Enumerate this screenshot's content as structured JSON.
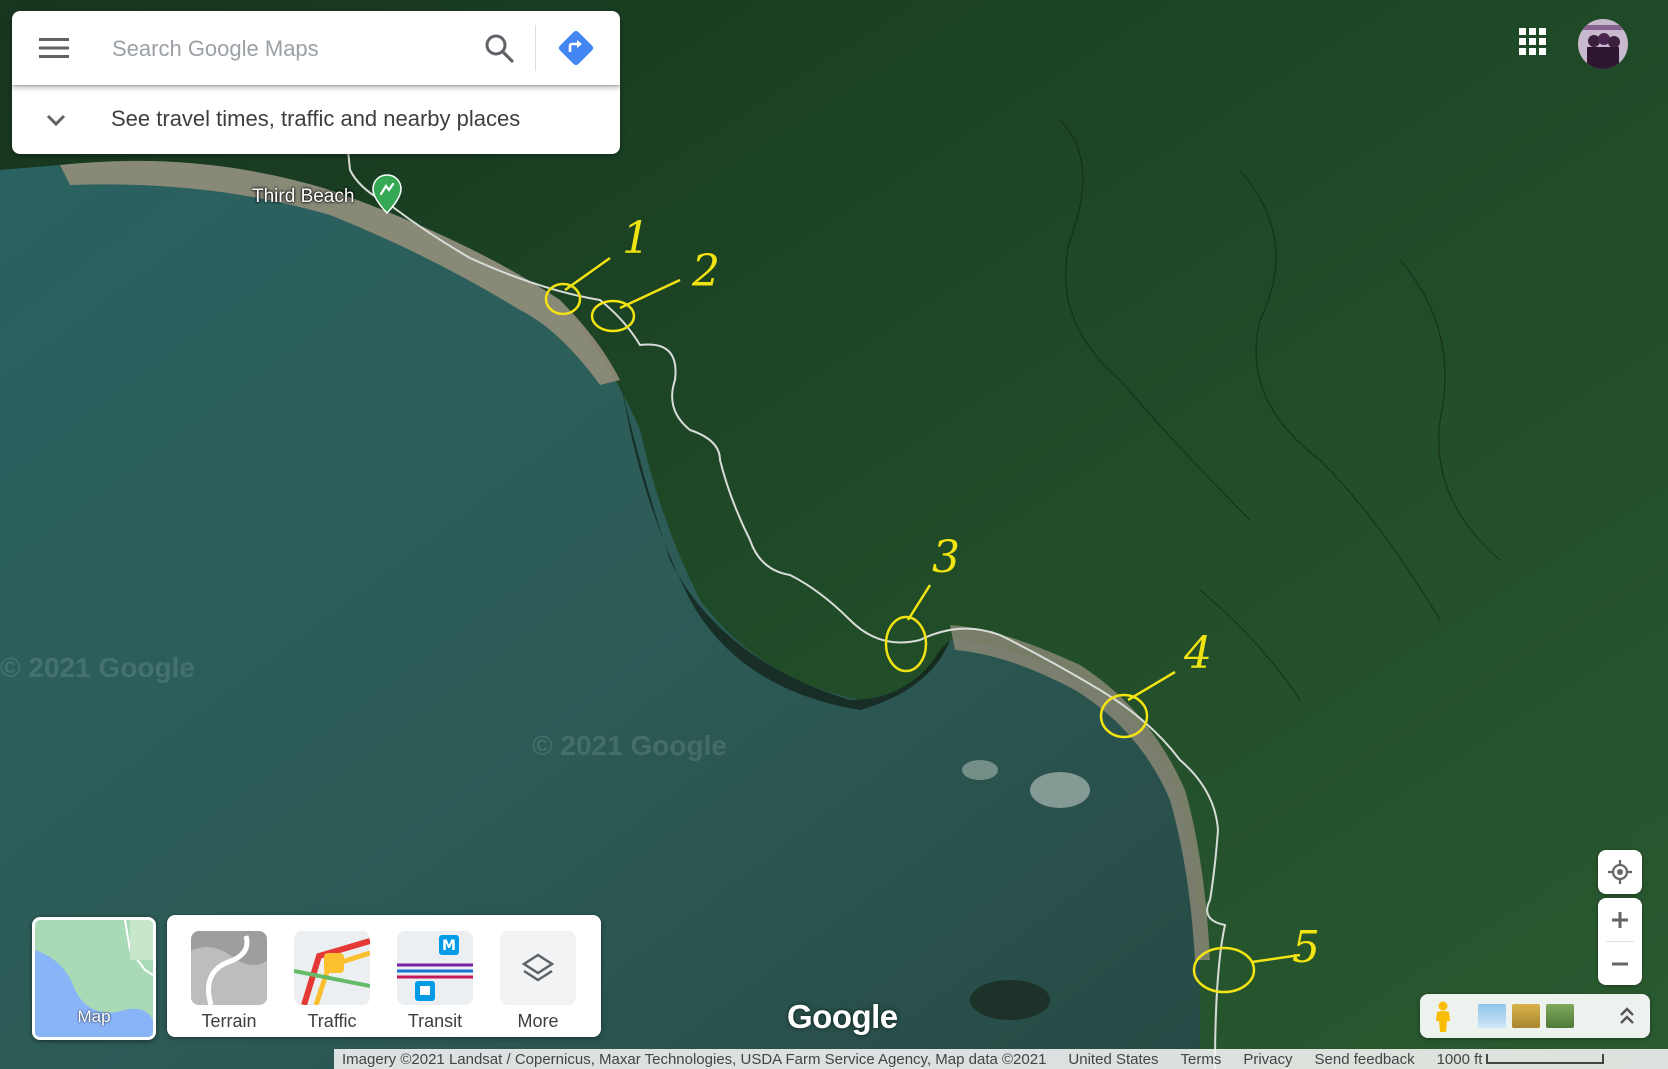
{
  "search": {
    "placeholder": "Search Google Maps",
    "travel_hint": "See travel times, traffic and nearby places"
  },
  "map": {
    "place_label": "Third Beach",
    "watermark_left": "© 2021 Google",
    "watermark_center": "© 2021 Google",
    "annotations": [
      "1",
      "2",
      "3",
      "4",
      "5"
    ],
    "annotation_color": "#f2e313"
  },
  "map_type": {
    "label": "Map"
  },
  "layers": [
    {
      "label": "Terrain"
    },
    {
      "label": "Traffic"
    },
    {
      "label": "Transit"
    },
    {
      "label": "More"
    }
  ],
  "logo": "Google",
  "attribution": {
    "imagery": "Imagery ©2021 Landsat / Copernicus, Maxar Technologies, USDA Farm Service Agency, Map data ©2021",
    "region": "United States",
    "terms": "Terms",
    "privacy": "Privacy",
    "feedback": "Send feedback",
    "scale": "1000 ft"
  },
  "icons": {
    "menu": "hamburger-menu-icon",
    "search": "search-icon",
    "directions": "directions-icon",
    "expand": "chevron-down-icon",
    "apps": "apps-grid-icon",
    "locate": "my-location-icon",
    "zoom_in": "plus-icon",
    "zoom_out": "minus-icon",
    "pegman": "pegman-icon",
    "collapse": "double-chevron-up-icon",
    "place_pin": "hiking-pin-icon",
    "layers_more": "layers-icon"
  },
  "colors": {
    "accent_blue": "#4285f4",
    "pin_green": "#34a853",
    "forest_dark": "#1c3a22",
    "water": "#2c5a5a"
  }
}
